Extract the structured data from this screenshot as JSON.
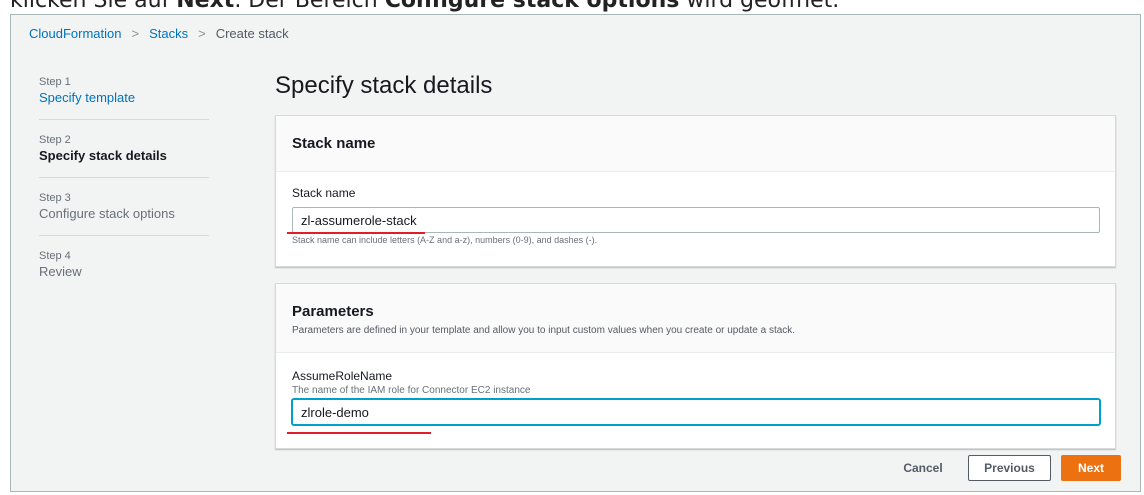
{
  "caption": {
    "prefix": "klicken Sie auf ",
    "next_bold": "Next",
    "middle": ". Der Bereich ",
    "configure_bold": "Configure stack options",
    "suffix": " wird geöffnet."
  },
  "breadcrumb": {
    "items": [
      "CloudFormation",
      "Stacks",
      "Create stack"
    ]
  },
  "steps": [
    {
      "num": "Step 1",
      "title": "Specify template"
    },
    {
      "num": "Step 2",
      "title": "Specify stack details"
    },
    {
      "num": "Step 3",
      "title": "Configure stack options"
    },
    {
      "num": "Step 4",
      "title": "Review"
    }
  ],
  "page_title": "Specify stack details",
  "stack_name_panel": {
    "heading": "Stack name",
    "field_label": "Stack name",
    "value": "zl-assumerole-stack",
    "constraint": "Stack name can include letters (A-Z and a-z), numbers (0-9), and dashes (-)."
  },
  "parameters_panel": {
    "heading": "Parameters",
    "description": "Parameters are defined in your template and allow you to input custom values when you create or update a stack.",
    "field_label": "AssumeRoleName",
    "field_description": "The name of the IAM role for Connector EC2 instance",
    "value": "zlrole-demo"
  },
  "buttons": {
    "cancel": "Cancel",
    "previous": "Previous",
    "next": "Next"
  },
  "colors": {
    "link": "#0073bb",
    "primary_button": "#ec7211",
    "annotation_underline": "#e11d2a"
  }
}
